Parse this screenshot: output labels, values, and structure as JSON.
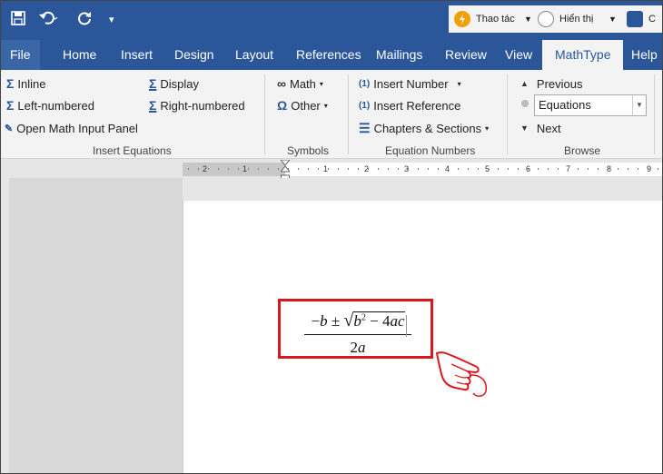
{
  "quick_access": {
    "save_icon": "save-icon",
    "undo_icon": "undo-icon",
    "redo_icon": "redo-icon",
    "customize_icon": "customize-qat-icon"
  },
  "right_panel": {
    "thao_tac_label": "Thao tác",
    "hien_thi_label": "Hiển thị",
    "extra_label": "C"
  },
  "tabs": [
    {
      "label": "File"
    },
    {
      "label": "Home"
    },
    {
      "label": "Insert"
    },
    {
      "label": "Design"
    },
    {
      "label": "Layout"
    },
    {
      "label": "References"
    },
    {
      "label": "Mailings"
    },
    {
      "label": "Review"
    },
    {
      "label": "View"
    },
    {
      "label": "MathType"
    },
    {
      "label": "Help"
    }
  ],
  "ribbon": {
    "insert_equations": {
      "inline": "Inline",
      "left_numbered": "Left-numbered",
      "open_math_input_panel": "Open Math Input Panel",
      "display": "Display",
      "right_numbered": "Right-numbered",
      "group_label": "Insert Equations"
    },
    "symbols": {
      "math": "Math",
      "other": "Other",
      "group_label": "Symbols"
    },
    "equation_numbers": {
      "insert_number": "Insert Number",
      "insert_reference": "Insert Reference",
      "chapters_sections": "Chapters & Sections",
      "group_label": "Equation Numbers"
    },
    "browse": {
      "previous": "Previous",
      "combo_value": "Equations",
      "next": "Next",
      "group_label": "Browse"
    }
  },
  "ruler": {
    "ticks": [
      "2",
      "1",
      "1",
      "2",
      "3",
      "4",
      "5",
      "6",
      "7",
      "8",
      "9"
    ]
  },
  "equation": {
    "numerator": "−b ± √b² − 4ac",
    "numerator_parts": {
      "pre": "−",
      "b1": "b",
      "pm": " ± ",
      "sqrt": "√",
      "b2": "b",
      "exp": "2",
      "minus": " − 4",
      "ac": "ac"
    },
    "denominator_num": "2",
    "denominator_var": "a"
  },
  "colors": {
    "title_blue": "#2b579a",
    "highlight_red": "#d7191f"
  }
}
